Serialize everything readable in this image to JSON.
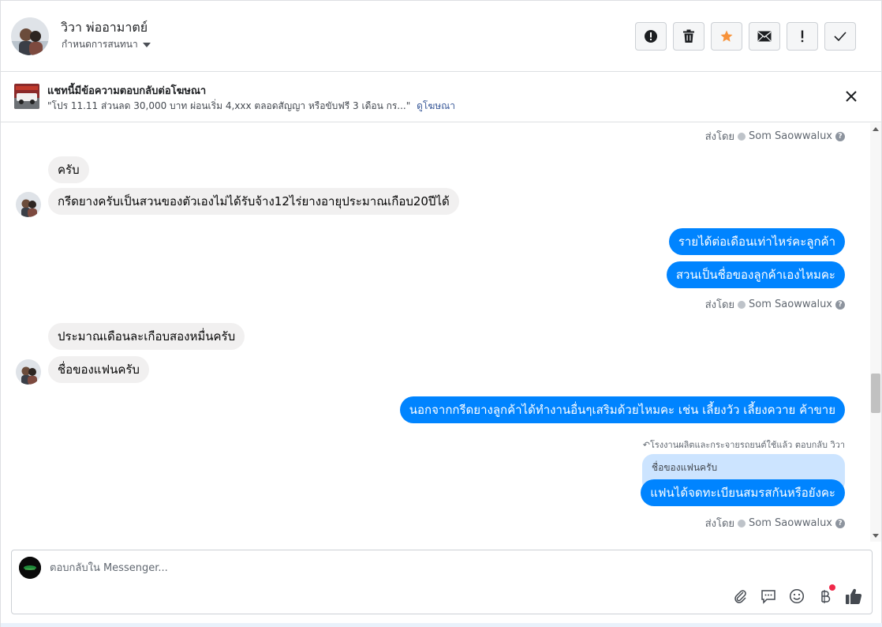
{
  "header": {
    "contact_name": "วิวา พ่ออามาตย์",
    "assign_label": "กำหนดการสนทนา",
    "actions": [
      {
        "name": "spam-button",
        "glyph": "!"
      },
      {
        "name": "delete-button",
        "glyph": ""
      },
      {
        "name": "star-button",
        "glyph": "★"
      },
      {
        "name": "mark-unread-button",
        "glyph": "✉"
      },
      {
        "name": "follow-up-button",
        "glyph": "!"
      },
      {
        "name": "done-button",
        "glyph": "✓"
      }
    ]
  },
  "ad_banner": {
    "title": "แชทนี้มีข้อความตอบกลับต่อโฆษณา",
    "description": "\"โปร 11.11 ส่วนลด 30,000 บาท ผ่อนเริ่ม 4,xxx ตลอดสัญญา หรือขับฟรี 3 เดือน กร...\"",
    "link": "ดูโฆษณา"
  },
  "messages": {
    "sent_prefix": "ส่งโดย",
    "agent_name": "Som Saowwalux",
    "help_glyph": "?",
    "in_1": "ครับ",
    "in_2": "กรีดยางครับเป็นสวนของตัวเองไม่ได้รับจ้าง12ไร่ยางอายุประมาณเกือบ20ปีได้",
    "out_1": "รายได้ต่อเดือนเท่าไหร่คะลูกค้า",
    "out_2": "สวนเป็นชื่อของลูกค้าเองไหมคะ",
    "in_3": "ประมาณเดือนละเกือบสองหมื่นครับ",
    "in_4": "ชื่อของแฟนครับ",
    "out_3": "นอกจากกรีดยางลูกค้าได้ทำงานอื่นๆเสริมด้วยไหมคะ เช่น เลี้ยงวัว เลี้ยงควาย ค้าขาย",
    "reply_meta": "โรงงานผลิตและกระจายรถยนต์ใช้แล้ว ตอบกลับ วิวา",
    "quoted_text": "ชื่อของแฟนครับ",
    "out_4": "แฟนได้จดทะเบียนสมรสกันหรือยังคะ"
  },
  "composer": {
    "placeholder": "ตอบกลับใน Messenger..."
  },
  "colors": {
    "outgoing_bubble": "#0084ff",
    "incoming_bubble": "#f1f0f0",
    "quoted_bubble": "#cce4ff",
    "star": "#f7923a",
    "notification": "#f02849"
  }
}
